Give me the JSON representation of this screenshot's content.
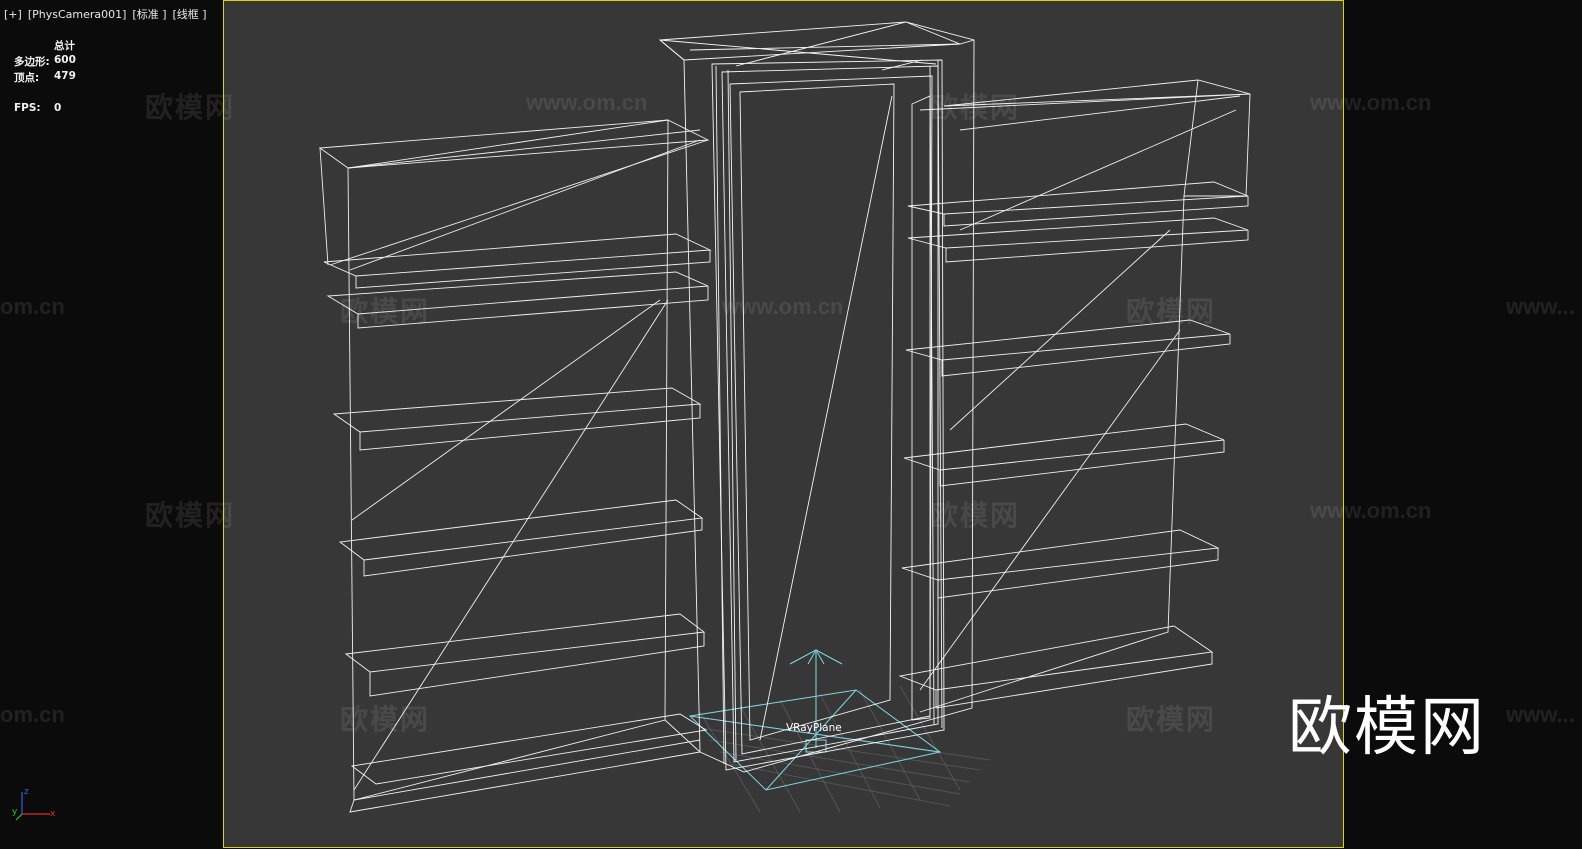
{
  "viewport": {
    "label_parts": [
      "[+]",
      "[PhysCamera001]",
      "[标准 ]",
      "[线框 ]"
    ]
  },
  "stats": {
    "header": "总计",
    "polygons_label": "多边形:",
    "polygons_value": "600",
    "vertices_label": "顶点:",
    "vertices_value": "479",
    "fps_label": "FPS:",
    "fps_value": "0"
  },
  "scene": {
    "object_label": "VRayPlane",
    "wire_color": "#ffffff",
    "light_color": "#7fd8e0",
    "frame_color": "#d8d800",
    "viewport_bg": "#373737"
  },
  "watermarks": {
    "cn": "欧模网",
    "url": "www.om.cn",
    "url_partial": "om.cn",
    "url_cut": "www..."
  },
  "logo": "欧模网",
  "axis": {
    "x": "x",
    "y": "y",
    "z": "z"
  }
}
